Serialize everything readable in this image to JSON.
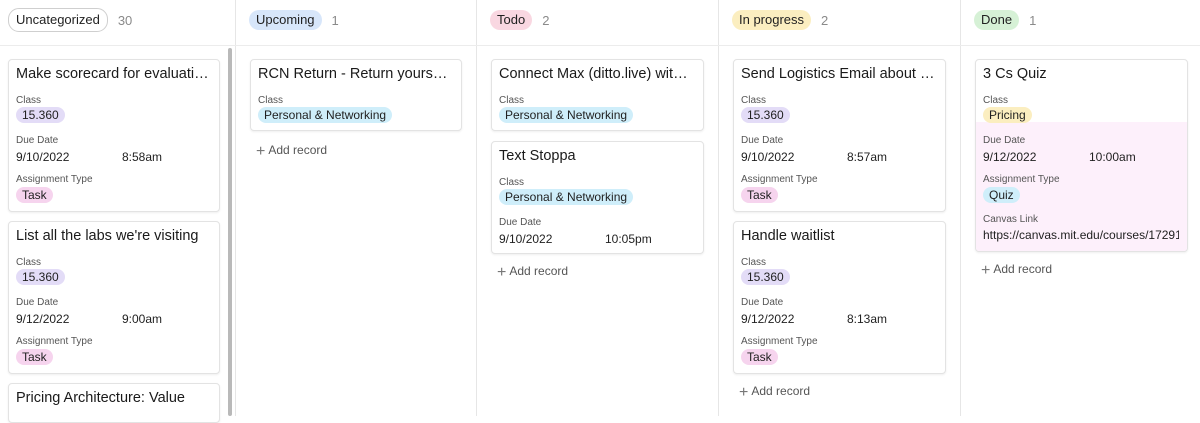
{
  "colors": {
    "class_15360": "#e3dcf7",
    "class_personal": "#cfeefa",
    "class_pricing": "#fbeec0",
    "type_task": "#f6d4ee",
    "type_quiz": "#cfeefa"
  },
  "columns": [
    {
      "name": "Uncategorized",
      "count": "30",
      "color": "#ffffff"
    },
    {
      "name": "Upcoming",
      "count": "1",
      "color": "#d7e6fa"
    },
    {
      "name": "Todo",
      "count": "2",
      "color": "#f9d7e1"
    },
    {
      "name": "In progress",
      "count": "2",
      "color": "#fbeec0"
    },
    {
      "name": "Done",
      "count": "1",
      "color": "#d6f1d6"
    }
  ],
  "labels": {
    "class": "Class",
    "due_date": "Due Date",
    "assignment_type": "Assignment Type",
    "canvas_link": "Canvas Link",
    "add_record": "Add record"
  },
  "uncategorized": [
    {
      "title": "Make scorecard for evaluating...",
      "class": "15.360",
      "due_date": "9/10/2022",
      "due_time": "8:58am",
      "type": "Task"
    },
    {
      "title": "List all the labs we're visiting",
      "class": "15.360",
      "due_date": "9/12/2022",
      "due_time": "9:00am",
      "type": "Task"
    },
    {
      "title": "Pricing Architecture: Value"
    }
  ],
  "upcoming": [
    {
      "title": "RCN Return - Return yourself ...",
      "class": "Personal & Networking"
    }
  ],
  "todo": [
    {
      "title": "Connect Max (ditto.live) with ...",
      "class": "Personal & Networking"
    },
    {
      "title": "Text Stoppa",
      "class": "Personal & Networking",
      "due_date": "9/10/2022",
      "due_time": "10:05pm"
    }
  ],
  "in_progress": [
    {
      "title": "Send Logistics Email about Ro...",
      "class": "15.360",
      "due_date": "9/10/2022",
      "due_time": "8:57am",
      "type": "Task"
    },
    {
      "title": "Handle waitlist",
      "class": "15.360",
      "due_date": "9/12/2022",
      "due_time": "8:13am",
      "type": "Task"
    }
  ],
  "done": [
    {
      "title": "3 Cs Quiz",
      "class": "Pricing",
      "due_date": "9/12/2022",
      "due_time": "10:00am",
      "type": "Quiz",
      "canvas_link": "https://canvas.mit.edu/courses/17291..."
    }
  ]
}
